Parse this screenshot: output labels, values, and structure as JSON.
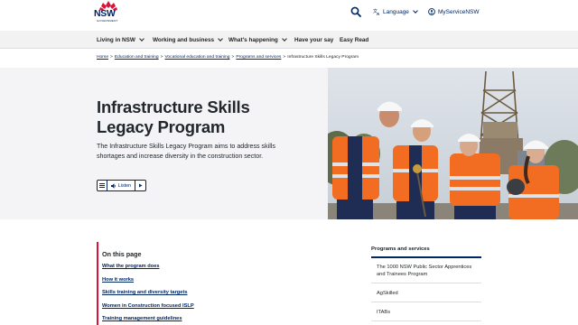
{
  "header": {
    "logo_text": "NSW",
    "logo_sub": "GOVERNMENT",
    "language_label": "Language",
    "my_service_label": "MyServiceNSW"
  },
  "nav": {
    "items": [
      {
        "label": "Living in NSW",
        "has_chevron": true
      },
      {
        "label": "Working and business",
        "has_chevron": true
      },
      {
        "label": "What's happening",
        "has_chevron": true
      },
      {
        "label": "Have your say",
        "has_chevron": false
      },
      {
        "label": "Easy Read",
        "has_chevron": false
      }
    ]
  },
  "breadcrumb": {
    "items": [
      "Home",
      "Education and training",
      "Vocational education and training",
      "Programs and services"
    ],
    "current": "Infrastructure Skills Legacy Program",
    "separator": ">"
  },
  "hero": {
    "title": "Infrastructure Skills Legacy Program",
    "description": "The Infrastructure Skills Legacy Program aims to address skills shortages and increase diversity in the construction sector.",
    "listen_label": "Listen"
  },
  "on_this_page": {
    "title": "On this page",
    "links": [
      "What the program does",
      "How it works",
      "Skills training and diversity targets",
      "Women in Construction focused ISLP",
      "Training management guidelines"
    ]
  },
  "side_nav": {
    "title": "Programs and services",
    "items": [
      "The 1000 NSW Public Sector Apprentices and Trainees Program",
      "AgSkilled",
      "ITABs"
    ]
  },
  "colors": {
    "brand_navy": "#002664",
    "accent_red": "#d7153a",
    "hero_bg": "#f4f4f7",
    "nav_bg": "#f2f2f2",
    "hi_vis_orange": "#f26d21"
  }
}
